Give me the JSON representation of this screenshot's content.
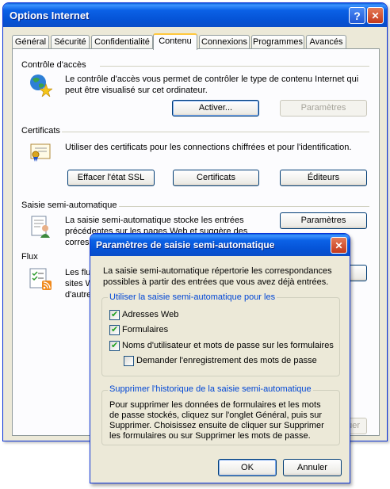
{
  "main_window": {
    "title": "Options Internet",
    "help_glyph": "?",
    "close_glyph": "✕",
    "tabs": [
      "Général",
      "Sécurité",
      "Confidentialité",
      "Contenu",
      "Connexions",
      "Programmes",
      "Avancés"
    ],
    "active_tab": "Contenu"
  },
  "content": {
    "access_control": {
      "label": "Contrôle d'accès",
      "description_line1": "Le contrôle d'accès vous permet de contrôler le type de contenu Internet qui",
      "description_line2": "peut être visualisé sur cet ordinateur.",
      "enable_button": "Activer...",
      "settings_button": "Paramètres",
      "icon": "globe-star-icon"
    },
    "certificates": {
      "label": "Certificats",
      "description": "Utiliser des certificats pour les connections chiffrées et pour l'identification.",
      "clear_ssl_button": "Effacer l'état SSL",
      "certificates_button": "Certificats",
      "publishers_button": "Éditeurs",
      "icon": "certificate-icon"
    },
    "autocomplete": {
      "label": "Saisie semi-automatique",
      "description_line1": "La saisie semi-automatique stocke les entrées",
      "description_line2": "précédentes sur les pages Web et suggère des",
      "description_line3": "correspo",
      "settings_button": "Paramètres",
      "icon": "autocomplete-form-icon"
    },
    "feeds": {
      "label": "Flux",
      "description_line1": "Les flux",
      "description_line2": "sites W",
      "description_line3": "d'autre",
      "hidden_button_fragment": "quer",
      "icon": "feed-list-icon"
    }
  },
  "dialog": {
    "title": "Paramètres de saisie semi-automatique",
    "close_glyph": "✕",
    "intro_line1": "La saisie semi-automatique répertorie les correspondances",
    "intro_line2": "possibles à partir des entrées que vous avez déjà entrées.",
    "use_group": {
      "label": "Utiliser la saisie semi-automatique pour les",
      "options": [
        {
          "label": "Adresses Web",
          "checked": true
        },
        {
          "label": "Formulaires",
          "checked": true
        },
        {
          "label": "Noms d'utilisateur et mots de passe sur les formulaires",
          "checked": true
        },
        {
          "label": "Demander l'enregistrement des mots de passe",
          "checked": false
        }
      ]
    },
    "history_group": {
      "label": "Supprimer l'historique de la saisie semi-automatique",
      "text_line1": "Pour supprimer les données de formulaires et les mots",
      "text_line2": "de passe stockés, cliquez sur l'onglet Général, puis sur",
      "text_line3": "Supprimer. Choisissez ensuite de cliquer sur Supprimer",
      "text_line4": "les formulaires ou sur Supprimer les mots de passe."
    },
    "ok_button": "OK",
    "cancel_button": "Annuler"
  }
}
